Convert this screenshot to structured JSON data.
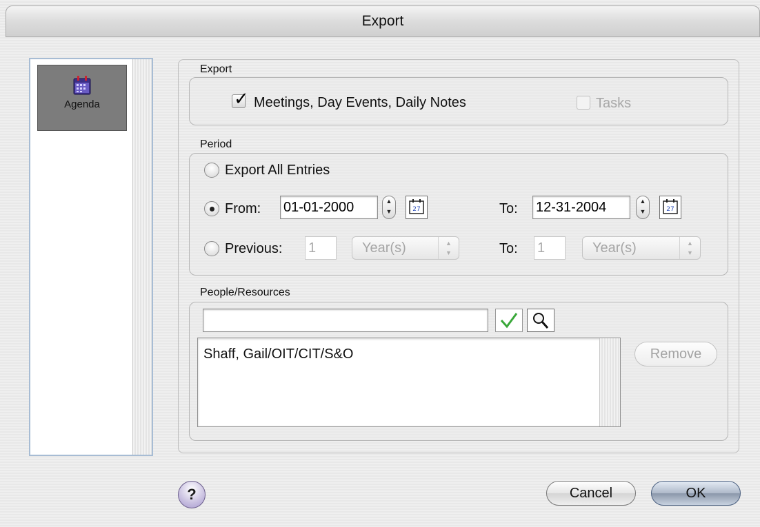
{
  "window": {
    "title": "Export"
  },
  "sidebar": {
    "items": [
      {
        "label": "Agenda",
        "icon": "calendar-icon",
        "selected": true
      }
    ]
  },
  "export_group": {
    "label": "Export",
    "meetings": {
      "label": "Meetings, Day Events, Daily Notes",
      "checked": true
    },
    "tasks": {
      "label": "Tasks",
      "checked": false,
      "enabled": false
    }
  },
  "period_group": {
    "label": "Period",
    "all_entries": {
      "label": "Export All Entries",
      "selected": false
    },
    "from": {
      "label": "From:",
      "selected": true,
      "value": "01-01-2000",
      "to_label": "To:",
      "to_value": "12-31-2004"
    },
    "previous": {
      "label": "Previous:",
      "selected": false,
      "count": "1",
      "unit": "Year(s)",
      "to_label": "To:",
      "to_count": "1",
      "to_unit": "Year(s)"
    }
  },
  "people_group": {
    "label": "People/Resources",
    "search_value": "",
    "entries": [
      "Shaff, Gail/OIT/CIT/S&O"
    ],
    "remove_label": "Remove"
  },
  "footer": {
    "help_label": "?",
    "cancel_label": "Cancel",
    "ok_label": "OK"
  },
  "colors": {
    "default_button": "#8b97aa",
    "checkmark_green": "#3aa83a",
    "help_button": "#c8bfe0"
  }
}
